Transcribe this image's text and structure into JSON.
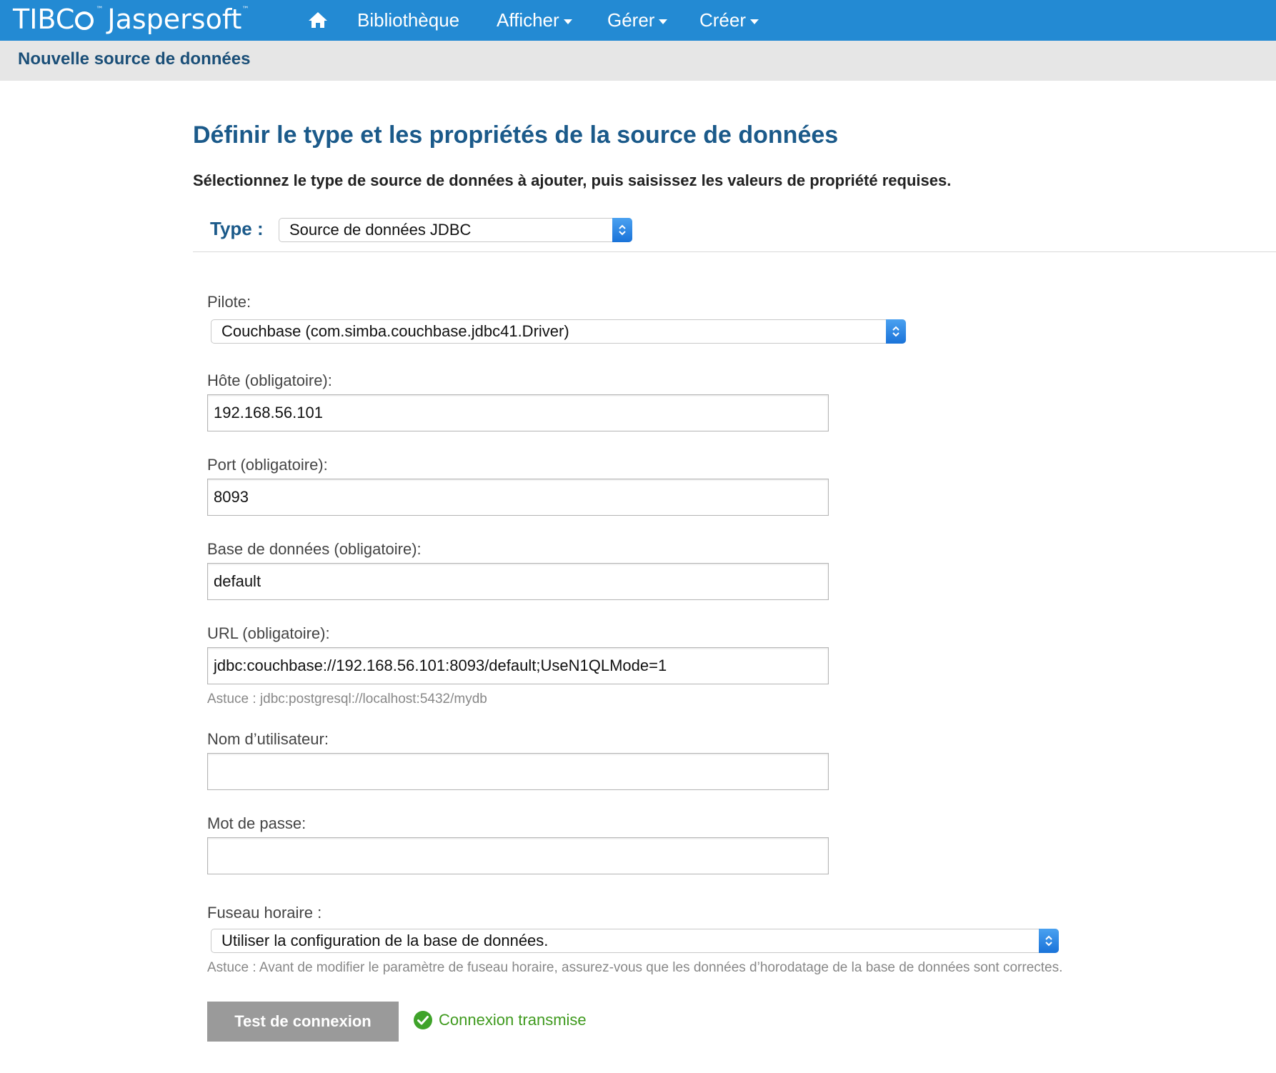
{
  "nav": {
    "logo_tibco_left": "TIBC",
    "logo_jaspersoft": "Jaspersoft",
    "logo_tm": "™",
    "items": [
      {
        "label": "Bibliothèque",
        "has_dropdown": false
      },
      {
        "label": "Afficher",
        "has_dropdown": true
      },
      {
        "label": "Gérer",
        "has_dropdown": true
      },
      {
        "label": "Créer",
        "has_dropdown": true
      }
    ]
  },
  "page": {
    "title": "Nouvelle source de données",
    "section_heading": "Définir le type et les propriétés de la source de données",
    "instructions": "Sélectionnez le type de source de données à ajouter, puis saisissez les valeurs de propriété requises."
  },
  "type": {
    "label": "Type :",
    "value": "Source de données JDBC"
  },
  "form": {
    "driver": {
      "label": "Pilote:",
      "value": "Couchbase (com.simba.couchbase.jdbc41.Driver)"
    },
    "host": {
      "label": "Hôte (obligatoire):",
      "value": "192.168.56.101"
    },
    "port": {
      "label": "Port (obligatoire):",
      "value": "8093"
    },
    "database": {
      "label": "Base de données (obligatoire):",
      "value": "default"
    },
    "url": {
      "label": "URL (obligatoire):",
      "value": "jdbc:couchbase://192.168.56.101:8093/default;UseN1QLMode=1",
      "hint": "Astuce : jdbc:postgresql://localhost:5432/mydb"
    },
    "username": {
      "label": "Nom d’utilisateur:",
      "value": ""
    },
    "password": {
      "label": "Mot de passe:",
      "value": ""
    },
    "timezone": {
      "label": "Fuseau horaire :",
      "value": "Utiliser la configuration de la base de données.",
      "hint": "Astuce : Avant de modifier le paramètre de fuseau horaire, assurez-vous que les données d’horodatage de la base de données sont correctes."
    }
  },
  "actions": {
    "test_button": "Test de connexion",
    "status": "Connexion transmise"
  },
  "colors": {
    "nav_bg": "#238ad3",
    "heading": "#1b5a8a",
    "success": "#3f9a1e",
    "button_bg": "#9a9a9a"
  }
}
